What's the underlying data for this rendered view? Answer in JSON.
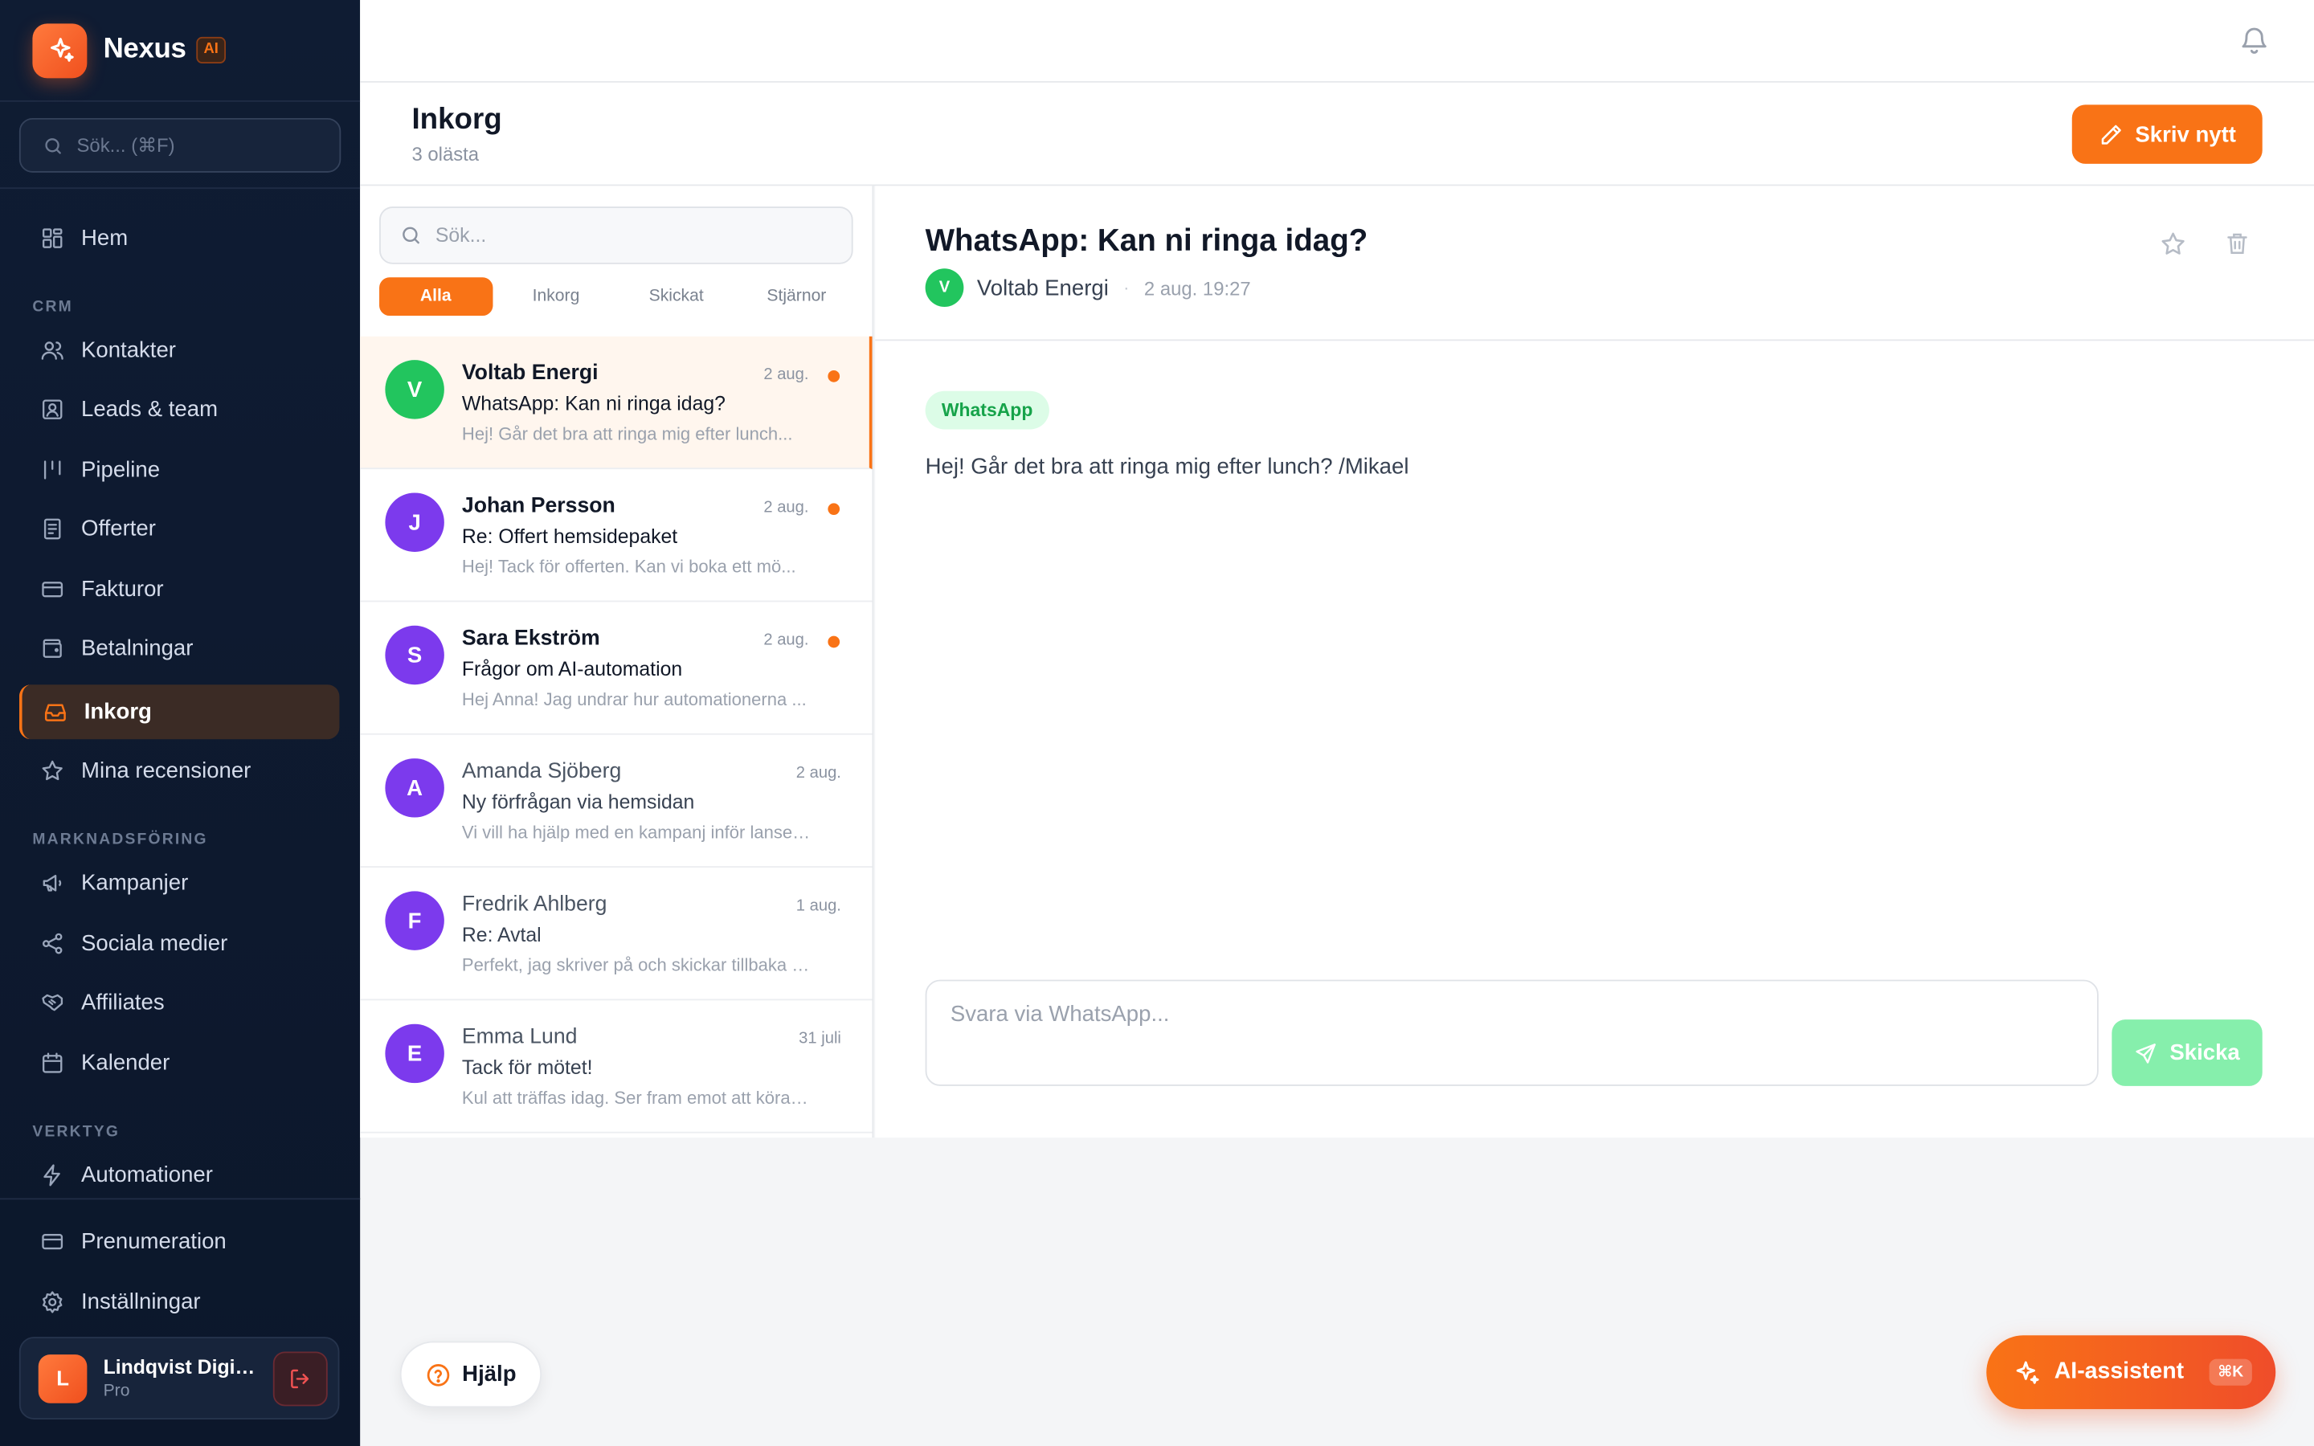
{
  "brand": {
    "name": "Nexus",
    "badge": "AI"
  },
  "sidebar": {
    "search_placeholder": "Sök... (⌘F)",
    "items": [
      {
        "label": "Hem",
        "icon": "grid-icon"
      },
      {
        "label": "Kontakter",
        "icon": "users-icon"
      },
      {
        "label": "Leads & team",
        "icon": "contact-card-icon"
      },
      {
        "label": "Pipeline",
        "icon": "pipeline-icon"
      },
      {
        "label": "Offerter",
        "icon": "document-icon"
      },
      {
        "label": "Fakturor",
        "icon": "credit-card-icon"
      },
      {
        "label": "Betalningar",
        "icon": "wallet-icon"
      },
      {
        "label": "Inkorg",
        "icon": "inbox-icon",
        "active": true
      },
      {
        "label": "Mina recensioner",
        "icon": "star-icon"
      },
      {
        "label": "Kampanjer",
        "icon": "megaphone-icon"
      },
      {
        "label": "Sociala medier",
        "icon": "share-icon"
      },
      {
        "label": "Affiliates",
        "icon": "handshake-icon"
      },
      {
        "label": "Kalender",
        "icon": "calendar-icon"
      },
      {
        "label": "Automationer",
        "icon": "lightning-icon"
      },
      {
        "label": "Prenumeration",
        "icon": "credit-card-icon"
      },
      {
        "label": "Inställningar",
        "icon": "gear-icon"
      }
    ],
    "sections": {
      "crm": "CRM",
      "marketing": "MARKNADSFÖRING",
      "tools": "VERKTYG"
    },
    "account": {
      "initial": "L",
      "name": "Lindqvist Digit...",
      "plan": "Pro"
    }
  },
  "header": {
    "title": "Inkorg",
    "subtitle": "3 olästa",
    "compose_label": "Skriv nytt"
  },
  "list": {
    "search_placeholder": "Sök...",
    "filters": [
      "Alla",
      "Inkorg",
      "Skickat",
      "Stjärnor"
    ],
    "active_filter": "Alla",
    "messages": [
      {
        "initial": "V",
        "sender": "Voltab Energi",
        "date": "2 aug.",
        "subject": "WhatsApp: Kan ni ringa idag?",
        "preview": "Hej! Går det bra att ringa mig efter lunch...",
        "unread": true,
        "selected": true,
        "color": "#22c55e"
      },
      {
        "initial": "J",
        "sender": "Johan Persson",
        "date": "2 aug.",
        "subject": "Re: Offert hemsidepaket",
        "preview": "Hej! Tack för offerten. Kan vi boka ett mö...",
        "unread": true,
        "selected": false,
        "color": "#7c3aed"
      },
      {
        "initial": "S",
        "sender": "Sara Ekström",
        "date": "2 aug.",
        "subject": "Frågor om AI-automation",
        "preview": "Hej Anna! Jag undrar hur automationerna ...",
        "unread": true,
        "selected": false,
        "color": "#7c3aed"
      },
      {
        "initial": "A",
        "sender": "Amanda Sjöberg",
        "date": "2 aug.",
        "subject": "Ny förfrågan via hemsidan",
        "preview": "Vi vill ha hjälp med en kampanj inför lansering...",
        "unread": false,
        "selected": false,
        "color": "#7c3aed"
      },
      {
        "initial": "F",
        "sender": "Fredrik Ahlberg",
        "date": "1 aug.",
        "subject": "Re: Avtal",
        "preview": "Perfekt, jag skriver på och skickar tillbaka im...",
        "unread": false,
        "selected": false,
        "color": "#7c3aed"
      },
      {
        "initial": "E",
        "sender": "Emma Lund",
        "date": "31 juli",
        "subject": "Tack för mötet!",
        "preview": "Kul att träffas idag. Ser fram emot att köra ig...",
        "unread": false,
        "selected": false,
        "color": "#7c3aed"
      }
    ]
  },
  "detail": {
    "subject": "WhatsApp: Kan ni ringa idag?",
    "sender_initial": "V",
    "sender": "Voltab Energi",
    "separator": "·",
    "date": "2 aug. 19:27",
    "channel": "WhatsApp",
    "body": "Hej! Går det bra att ringa mig efter lunch? /Mikael",
    "reply_placeholder": "Svara via WhatsApp...",
    "send_label": "Skicka"
  },
  "help_label": "Hjälp",
  "ai_assistant": {
    "label": "AI-assistent",
    "shortcut": "⌘K"
  },
  "colors": {
    "accent": "#f97316",
    "sidebar_bg": "#0f1c33",
    "whatsapp_green": "#22c55e",
    "avatar_purple": "#7c3aed"
  }
}
